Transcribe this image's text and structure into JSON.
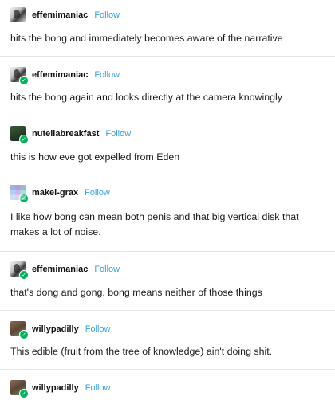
{
  "follow_label": "Follow",
  "posts": [
    {
      "username": "effemimaniac",
      "avatar_icon": "effemimaniac-avatar",
      "badge": false,
      "text": "hits the bong and immediately becomes aware of the narrative"
    },
    {
      "username": "effemimaniac",
      "avatar_icon": "effemimaniac-avatar",
      "badge": true,
      "text": "hits the bong again and looks directly at the camera knowingly"
    },
    {
      "username": "nutellabreakfast",
      "avatar_icon": "nutellabreakfast-avatar",
      "badge": true,
      "text": "this is how eve got expelled from Eden"
    },
    {
      "username": "makel-grax",
      "avatar_icon": "makel-grax-avatar",
      "badge": true,
      "text": "I like how bong can mean both penis and that big vertical disk that makes a lot of noise."
    },
    {
      "username": "effemimaniac",
      "avatar_icon": "effemimaniac-avatar",
      "badge": true,
      "text": "that's dong and gong. bong means neither of those things"
    },
    {
      "username": "willypadilly",
      "avatar_icon": "willypadilly-avatar",
      "badge": true,
      "text": "This edible (fruit from the tree of knowledge) ain't doing shit."
    },
    {
      "username": "willypadilly",
      "avatar_icon": "willypadilly-avatar",
      "badge": true,
      "text": ""
    }
  ],
  "colors": {
    "follow": "#39a0e0",
    "badge": "#00b35c",
    "divider": "#e3e3e3"
  }
}
